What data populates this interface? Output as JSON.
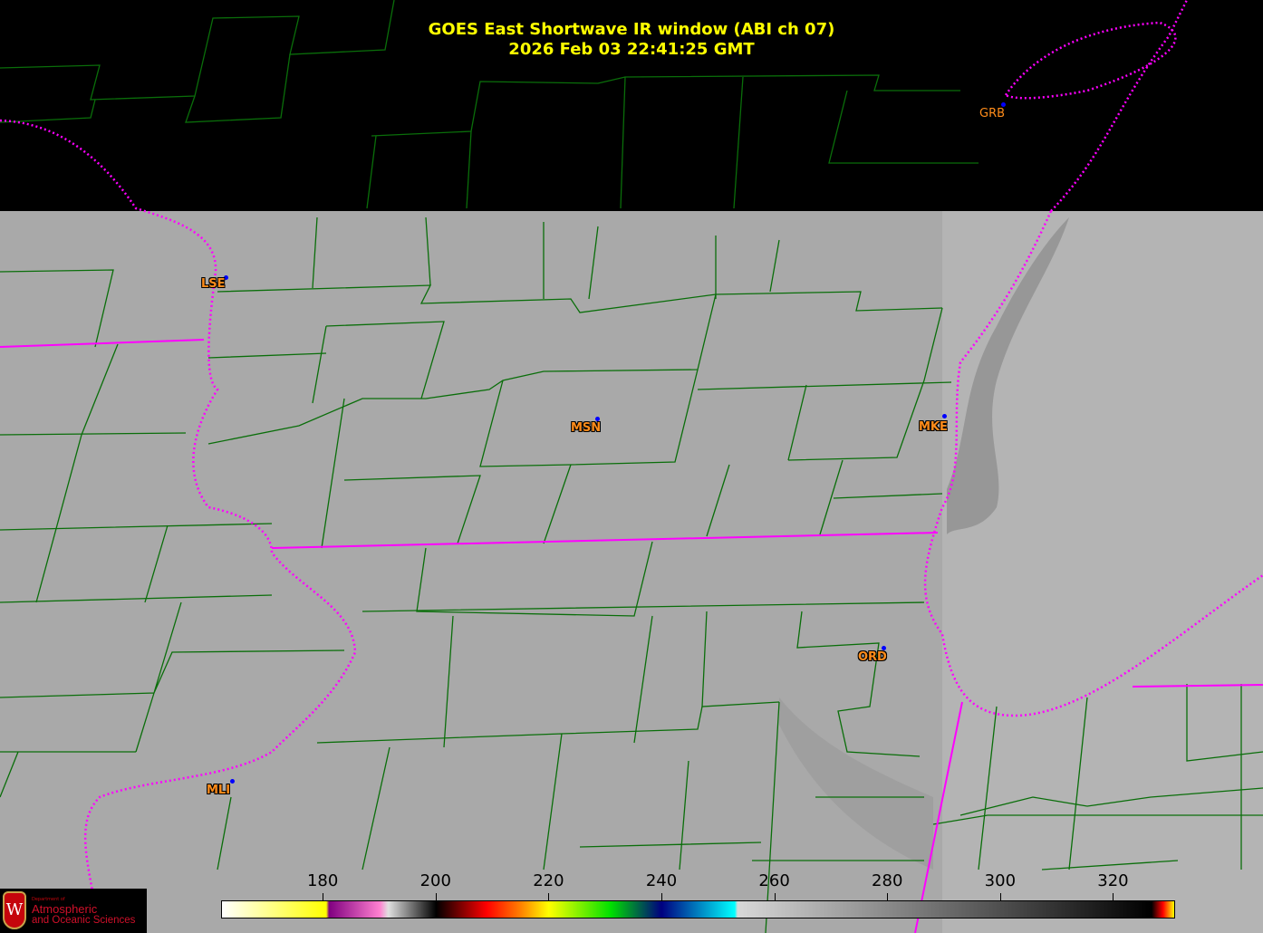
{
  "title": {
    "line1": "GOES East Shortwave IR window (ABI ch 07)",
    "line2": "2026 Feb 03  22:41:25 GMT"
  },
  "cities": [
    {
      "code": "GRB"
    },
    {
      "code": "LSE"
    },
    {
      "code": "MSN"
    },
    {
      "code": "MKE"
    },
    {
      "code": "ORD"
    },
    {
      "code": "MLI"
    }
  ],
  "colorbar": {
    "units_range": [
      162,
      331
    ],
    "ticks": [
      "180",
      "200",
      "220",
      "240",
      "260",
      "280",
      "300",
      "320"
    ],
    "tick_values": [
      180,
      200,
      220,
      240,
      260,
      280,
      300,
      320
    ],
    "stops": [
      {
        "value": 162,
        "color": "#ffffff"
      },
      {
        "value": 180.5,
        "color": "#ffff00"
      },
      {
        "value": 181,
        "color": "#800080"
      },
      {
        "value": 190,
        "color": "#ff80d0"
      },
      {
        "value": 191.5,
        "color": "#e0e0e0"
      },
      {
        "value": 200,
        "color": "#000000"
      },
      {
        "value": 209,
        "color": "#ff0000"
      },
      {
        "value": 215,
        "color": "#ff8000"
      },
      {
        "value": 220,
        "color": "#ffff00"
      },
      {
        "value": 231,
        "color": "#00e000"
      },
      {
        "value": 240,
        "color": "#000080"
      },
      {
        "value": 253,
        "color": "#00ffff"
      },
      {
        "value": 253.5,
        "color": "#d8d8d8"
      },
      {
        "value": 327,
        "color": "#000000"
      },
      {
        "value": 329,
        "color": "#ff0000"
      },
      {
        "value": 331,
        "color": "#ffff00"
      }
    ]
  },
  "logo": {
    "line1": "Department of",
    "line2": "Atmospheric",
    "line3": "and Oceanic Sciences",
    "shield_letter": "W"
  },
  "colors": {
    "county_lines": "#0a6e0a",
    "state_lines": "#ff00ff",
    "title": "#ffff00",
    "city_label": "#ff8c1a",
    "city_dot": "#0000ff"
  }
}
